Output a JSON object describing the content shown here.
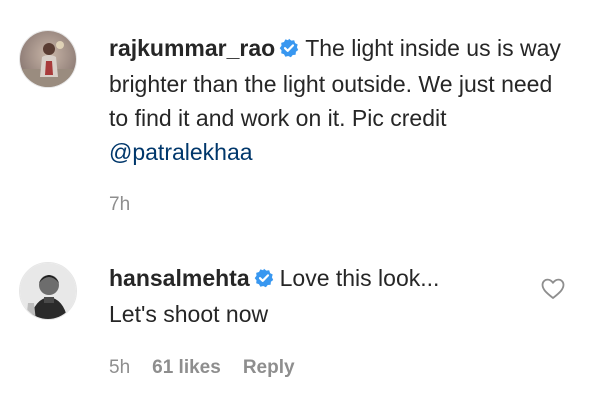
{
  "comments": [
    {
      "username": "rajkummar_rao",
      "verified": true,
      "text_before": "The light inside us is way brighter than the light outside. We just need to find it and work on it. Pic credit ",
      "mention": "@patralekhaa",
      "time": "7h",
      "likes": "",
      "reply_label": ""
    },
    {
      "username": "hansalmehta",
      "verified": true,
      "text_before": "Love this look... Let's shoot now",
      "mention": "",
      "time": "5h",
      "likes": "61 likes",
      "reply_label": "Reply"
    }
  ],
  "icons": {
    "verified": "verified-badge-icon",
    "like": "heart-outline-icon"
  },
  "colors": {
    "verified_blue": "#3897f0",
    "mention": "#00376b",
    "meta_gray": "#8e8e8e"
  }
}
